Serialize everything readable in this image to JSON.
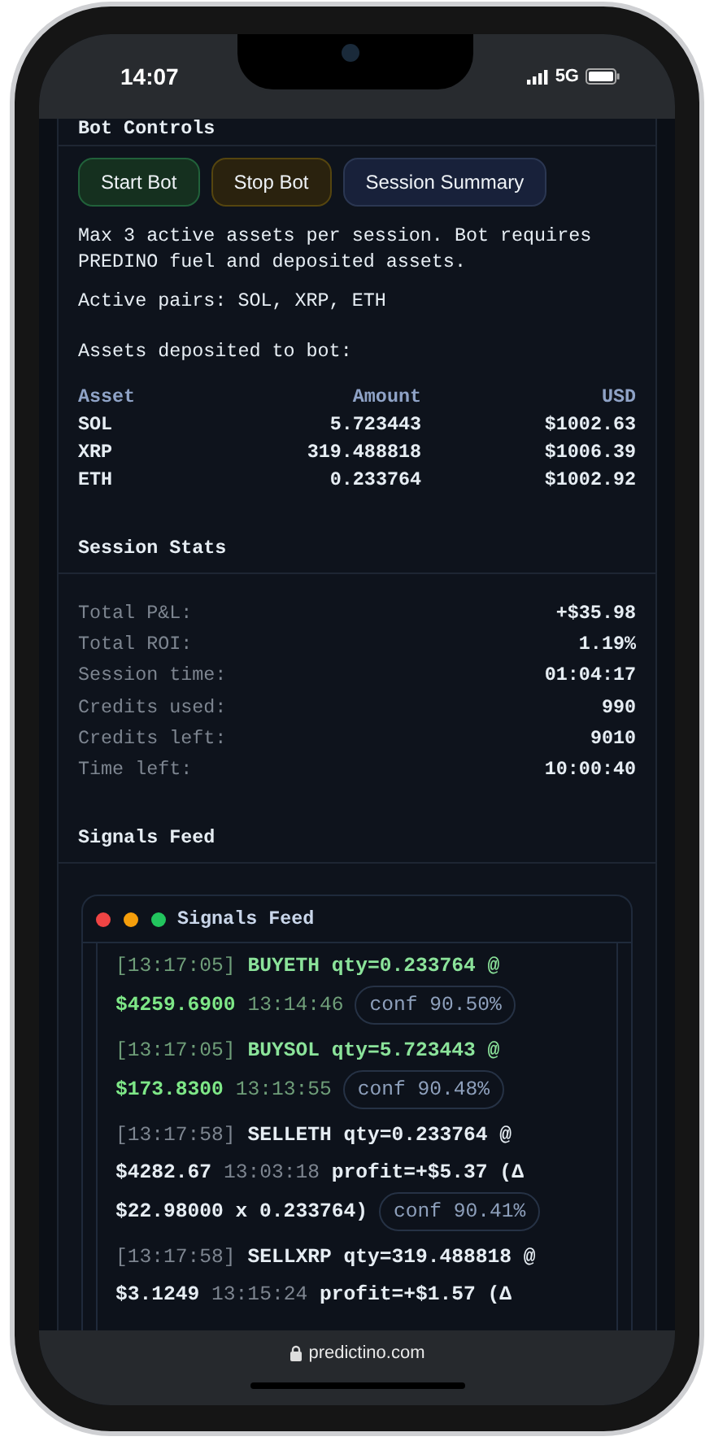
{
  "status_bar": {
    "time": "14:07",
    "network": "5G"
  },
  "browser_bar": {
    "url": "predictino.com"
  },
  "bot_controls": {
    "title": "Bot Controls",
    "buttons": [
      {
        "label": "Start Bot",
        "kind": "success"
      },
      {
        "label": "Stop Bot",
        "kind": "warning"
      },
      {
        "label": "Session Summary",
        "kind": "neutral"
      }
    ],
    "note": "Max 3 active assets per session. Bot requires PREDINO fuel and deposited assets.",
    "active_pairs": "Active pairs: SOL, XRP, ETH",
    "assets_heading": "Assets deposited to bot:",
    "table": {
      "columns": [
        "Asset",
        "Amount",
        "USD"
      ],
      "rows": [
        [
          "SOL",
          "5.723443",
          "$1002.63"
        ],
        [
          "XRP",
          "319.488818",
          "$1006.39"
        ],
        [
          "ETH",
          "0.233764",
          "$1002.92"
        ]
      ]
    }
  },
  "session_stats": {
    "title": "Session Stats",
    "rows": [
      {
        "label": "Total P&L:",
        "value": "+$35.98"
      },
      {
        "label": "Total ROI:",
        "value": "1.19%"
      },
      {
        "label": "Session time:",
        "value": "01:04:17"
      },
      {
        "label": "Credits used:",
        "value": "990"
      },
      {
        "label": "Credits left:",
        "value": "9010"
      },
      {
        "label": "Time left:",
        "value": "10:00:40"
      }
    ]
  },
  "signals_feed": {
    "title": "Signals Feed",
    "window_title": "Signals Feed",
    "entries": [
      {
        "kind": "buy",
        "time": "[13:17:05]",
        "action": "BUYETH qty=0.233764 @",
        "price": "$4259.6900",
        "at": "13:14:46",
        "conf": "conf 90.50%"
      },
      {
        "kind": "buy",
        "time": "[13:17:05]",
        "action": "BUYSOL qty=5.723443 @",
        "price": "$173.8300",
        "at": "13:13:55",
        "conf": "conf 90.48%"
      },
      {
        "kind": "sell",
        "time": "[13:17:58]",
        "action": "SELLETH qty=0.233764 @",
        "price": "$4282.67",
        "at": "13:03:18",
        "profit": "profit=+$5.37 (Δ",
        "profit_continued": "$22.98000 x 0.233764)",
        "conf": "conf 90.41%"
      },
      {
        "kind": "sell",
        "time": "[13:17:58]",
        "action": "SELLXRP qty=319.488818 @",
        "price": "$3.1249",
        "at": "13:15:24",
        "profit": "profit=+$1.57 (Δ"
      }
    ]
  }
}
